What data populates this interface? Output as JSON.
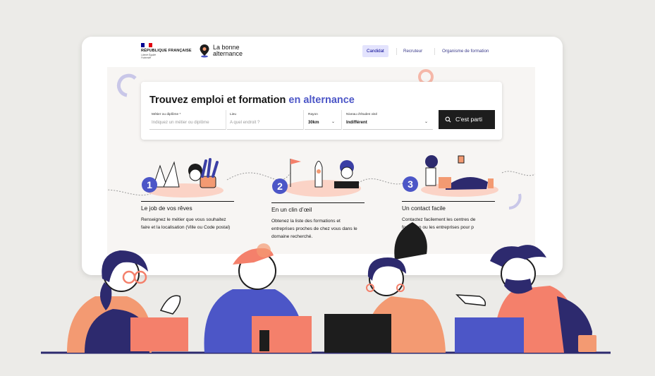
{
  "header": {
    "gov_title": "RÉPUBLIQUE FRANÇAISE",
    "gov_motto": "Liberté Égalité Fraternité",
    "brand_name": "La bonne alternance",
    "nav": [
      {
        "label": "Candidat",
        "active": true
      },
      {
        "label": "Recruteur",
        "active": false
      },
      {
        "label": "Organisme de formation",
        "active": false
      }
    ]
  },
  "search": {
    "headline_plain": "Trouvez emploi et formation",
    "headline_accent": "en alternance",
    "job_label": "Métier ou diplôme *",
    "job_placeholder": "Indiquez un métier ou diplôme",
    "place_label": "Lieu",
    "place_placeholder": "A quel endroit ?",
    "radius_label": "Rayon",
    "radius_value": "30km",
    "level_label": "Niveau d'études visé",
    "level_value": "Indifférent",
    "submit_label": "C'est parti"
  },
  "steps": [
    {
      "number": "1",
      "title": "Le job de vos rêves",
      "text": "Renseignez le métier que vous souhaitez faire et la localisation (Ville ou Code postal)"
    },
    {
      "number": "2",
      "title": "En un clin d’œil",
      "text": "Obtenez la liste des formations et entreprises proches de chez vous dans le domaine recherché."
    },
    {
      "number": "3",
      "title": "Un contact facile",
      "text": "Contactez facilement les centres de formation ou les entreprises pour p"
    }
  ],
  "colors": {
    "accent": "#4c56c7",
    "background": "#ecebe8",
    "panel": "#f7f5f3",
    "dark": "#1d1d1d",
    "navy": "#2d2a6e",
    "coral": "#f4806b",
    "orange": "#f39a72"
  },
  "icons": {
    "search": "search-icon",
    "chevron": "chevron-down-icon",
    "pin": "location-pin-icon"
  }
}
